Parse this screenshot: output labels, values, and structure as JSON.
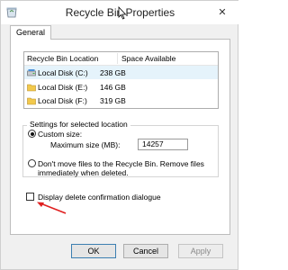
{
  "window": {
    "title": "Recycle Bin Properties",
    "close_symbol": "✕",
    "icon": "recycle-bin-icon"
  },
  "tabs": [
    {
      "label": "General"
    }
  ],
  "location_list": {
    "columns": [
      "Recycle Bin Location",
      "Space Available"
    ],
    "rows": [
      {
        "name": "Local Disk (C:)",
        "space": "238 GB",
        "icon": "local-disk-icon",
        "selected": true
      },
      {
        "name": "Local Disk (E:)",
        "space": "146 GB",
        "icon": "folder-drive-icon",
        "selected": false
      },
      {
        "name": "Local Disk (F:)",
        "space": "319 GB",
        "icon": "folder-drive-icon",
        "selected": false
      }
    ]
  },
  "settings": {
    "group_label": "Settings for selected location",
    "custom_size_label": "Custom size:",
    "custom_size_checked": true,
    "max_size_label": "Maximum size (MB):",
    "max_size_value": "14257",
    "dont_move_label_line1": "Don't move files to the Recycle Bin. Remove files",
    "dont_move_label_line2": "immediately when deleted.",
    "dont_move_checked": false
  },
  "confirm": {
    "label": "Display delete confirmation dialogue",
    "checked": false
  },
  "buttons": {
    "ok": "OK",
    "cancel": "Cancel",
    "apply": "Apply"
  },
  "colors": {
    "accent": "#3c7fb1",
    "annotation_arrow": "#e02020",
    "selection": "#e5f3fb"
  }
}
